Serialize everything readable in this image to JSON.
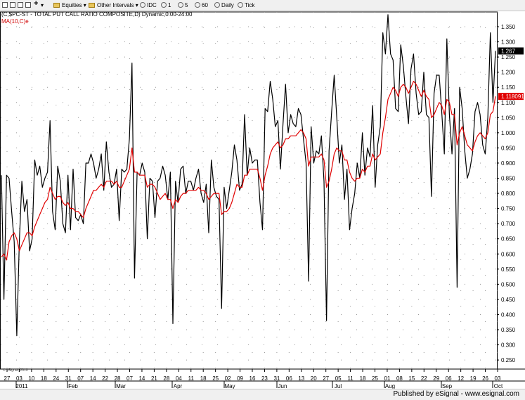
{
  "toolbar": {
    "items": [
      {
        "name": "equities-menu",
        "label": "Equities"
      },
      {
        "name": "other-intervals-menu",
        "label": "Other Intervals"
      },
      {
        "name": "interval-idc",
        "label": "IDC"
      },
      {
        "name": "interval-1",
        "label": "1"
      },
      {
        "name": "interval-5",
        "label": "5"
      },
      {
        "name": "interval-60",
        "label": "60"
      },
      {
        "name": "interval-daily",
        "label": "Daily"
      },
      {
        "name": "interval-tick",
        "label": "Tick"
      }
    ]
  },
  "chart": {
    "title": "(C,$PC-ST - TOTAL PUT CALL RATIO COMPOSITE,D) Dynamic,0:00-24:00",
    "ma_label": "MA(10,C)e",
    "watermark": "© eSignal, 2010",
    "last_value_label": "1.267",
    "ma_value_label": "1.118091",
    "colors": {
      "price": "#000000",
      "ma": "#e00000",
      "grid": "#999999"
    }
  },
  "footer": {
    "text": "Published by eSignal - www.esignal.com"
  },
  "chart_data": {
    "type": "line",
    "ylim": [
      0.225,
      1.4
    ],
    "y_ticks": [
      "1.350",
      "1.300",
      "1.250",
      "1.200",
      "1.150",
      "1.100",
      "1.050",
      "1.000",
      "0.950",
      "0.900",
      "0.850",
      "0.800",
      "0.750",
      "0.700",
      "0.650",
      "0.600",
      "0.550",
      "0.500",
      "0.450",
      "0.400",
      "0.350",
      "0.300",
      "0.250"
    ],
    "x_day_ticks": [
      "27",
      "03",
      "10",
      "18",
      "24",
      "31",
      "07",
      "14",
      "22",
      "28",
      "07",
      "14",
      "21",
      "28",
      "04",
      "11",
      "18",
      "25",
      "02",
      "09",
      "16",
      "23",
      "31",
      "06",
      "13",
      "20",
      "27",
      "05",
      "11",
      "18",
      "25",
      "01",
      "08",
      "15",
      "22",
      "29",
      "06",
      "12",
      "19",
      "26",
      "03"
    ],
    "x_month_ticks": [
      "2011",
      "Feb",
      "Mar",
      "Apr",
      "May",
      "Jun",
      "Jul",
      "Aug",
      "Sep",
      "Oct"
    ],
    "series": [
      {
        "values": [
          0.86,
          0.45,
          0.86,
          0.85,
          0.74,
          0.64,
          0.33,
          0.64,
          0.84,
          0.74,
          0.78,
          0.61,
          0.65,
          0.91,
          0.86,
          0.89,
          0.82,
          0.85,
          0.87,
          1.04,
          0.74,
          0.68,
          0.89,
          0.84,
          0.7,
          0.67,
          0.86,
          0.68,
          0.88,
          0.72,
          0.71,
          0.73,
          0.7,
          0.9,
          0.9,
          0.93,
          0.9,
          0.85,
          0.88,
          0.93,
          0.81,
          0.97,
          0.87,
          0.82,
          0.83,
          0.88,
          0.71,
          0.88,
          0.87,
          0.88,
          0.98,
          1.23,
          0.52,
          0.87,
          0.86,
          0.9,
          0.87,
          0.65,
          0.85,
          0.84,
          0.72,
          0.84,
          0.85,
          0.89,
          0.86,
          0.78,
          0.87,
          0.37,
          0.84,
          0.77,
          0.88,
          0.89,
          0.8,
          0.84,
          0.84,
          0.81,
          0.85,
          0.88,
          0.8,
          0.77,
          0.83,
          0.67,
          0.91,
          0.82,
          0.79,
          0.78,
          0.42,
          0.82,
          0.75,
          0.81,
          0.87,
          0.96,
          0.91,
          0.81,
          0.83,
          1.06,
          0.86,
          0.95,
          0.9,
          0.91,
          0.91,
          0.77,
          0.68,
          1.08,
          1.07,
          1.17,
          1.11,
          1.02,
          1.04,
          0.88,
          1.03,
          1.16,
          1.0,
          1.06,
          1.03,
          1.02,
          1.08,
          1.06,
          0.98,
          0.9,
          0.51,
          1.02,
          0.9,
          0.94,
          0.93,
          0.99,
          0.84,
          0.38,
          0.94,
          1.07,
          1.19,
          1.05,
          0.9,
          0.96,
          0.78,
          0.88,
          0.68,
          0.75,
          0.8,
          0.9,
          0.85,
          1.0,
          0.86,
          0.95,
          0.92,
          1.09,
          0.82,
          0.96,
          1.02,
          1.33,
          1.26,
          1.39,
          1.26,
          1.24,
          1.08,
          1.07,
          1.29,
          1.22,
          1.12,
          1.03,
          1.21,
          1.26,
          1.13,
          1.06,
          1.07,
          1.2,
          1.06,
          1.05,
          0.79,
          1.13,
          1.19,
          1.19,
          1.07,
          0.93,
          1.31,
          1.06,
          0.93,
          1.08,
          0.49,
          1.15,
          1.08,
          0.94,
          0.85,
          0.88,
          0.93,
          1.07,
          1.1,
          1.06,
          0.96,
          0.93,
          1.05,
          1.33,
          1.1,
          1.27
        ]
      },
      {
        "values": [
          0.59,
          0.6,
          0.58,
          0.64,
          0.66,
          0.67,
          0.65,
          0.61,
          0.63,
          0.65,
          0.67,
          0.67,
          0.66,
          0.69,
          0.71,
          0.73,
          0.75,
          0.77,
          0.78,
          0.82,
          0.8,
          0.78,
          0.79,
          0.79,
          0.77,
          0.76,
          0.77,
          0.75,
          0.75,
          0.74,
          0.74,
          0.73,
          0.72,
          0.75,
          0.77,
          0.79,
          0.81,
          0.81,
          0.82,
          0.83,
          0.82,
          0.84,
          0.84,
          0.84,
          0.83,
          0.84,
          0.82,
          0.82,
          0.84,
          0.86,
          0.88,
          0.95,
          0.87,
          0.87,
          0.86,
          0.86,
          0.86,
          0.82,
          0.83,
          0.83,
          0.82,
          0.8,
          0.78,
          0.79,
          0.8,
          0.78,
          0.78,
          0.75,
          0.78,
          0.77,
          0.79,
          0.8,
          0.8,
          0.81,
          0.81,
          0.81,
          0.81,
          0.82,
          0.81,
          0.81,
          0.8,
          0.78,
          0.79,
          0.8,
          0.8,
          0.8,
          0.73,
          0.74,
          0.74,
          0.75,
          0.77,
          0.8,
          0.83,
          0.82,
          0.82,
          0.86,
          0.86,
          0.88,
          0.88,
          0.88,
          0.88,
          0.85,
          0.81,
          0.86,
          0.89,
          0.93,
          0.95,
          0.96,
          0.97,
          0.95,
          0.96,
          0.98,
          0.98,
          0.99,
          0.99,
          0.99,
          1.0,
          1.01,
          1.0,
          0.98,
          0.89,
          0.92,
          0.92,
          0.92,
          0.92,
          0.93,
          0.91,
          0.82,
          0.84,
          0.88,
          0.93,
          0.95,
          0.94,
          0.94,
          0.91,
          0.91,
          0.87,
          0.85,
          0.84,
          0.85,
          0.85,
          0.88,
          0.87,
          0.89,
          0.89,
          0.93,
          0.91,
          0.92,
          0.93,
          1.0,
          1.05,
          1.11,
          1.13,
          1.15,
          1.14,
          1.12,
          1.15,
          1.16,
          1.15,
          1.13,
          1.15,
          1.17,
          1.16,
          1.14,
          1.12,
          1.14,
          1.12,
          1.11,
          1.05,
          1.06,
          1.08,
          1.1,
          1.09,
          1.06,
          1.11,
          1.1,
          1.06,
          1.06,
          0.96,
          1.0,
          1.02,
          0.99,
          0.96,
          0.95,
          0.94,
          0.97,
          0.99,
          1.0,
          0.99,
          0.98,
          1.0,
          1.06,
          1.07,
          1.12
        ]
      }
    ]
  }
}
